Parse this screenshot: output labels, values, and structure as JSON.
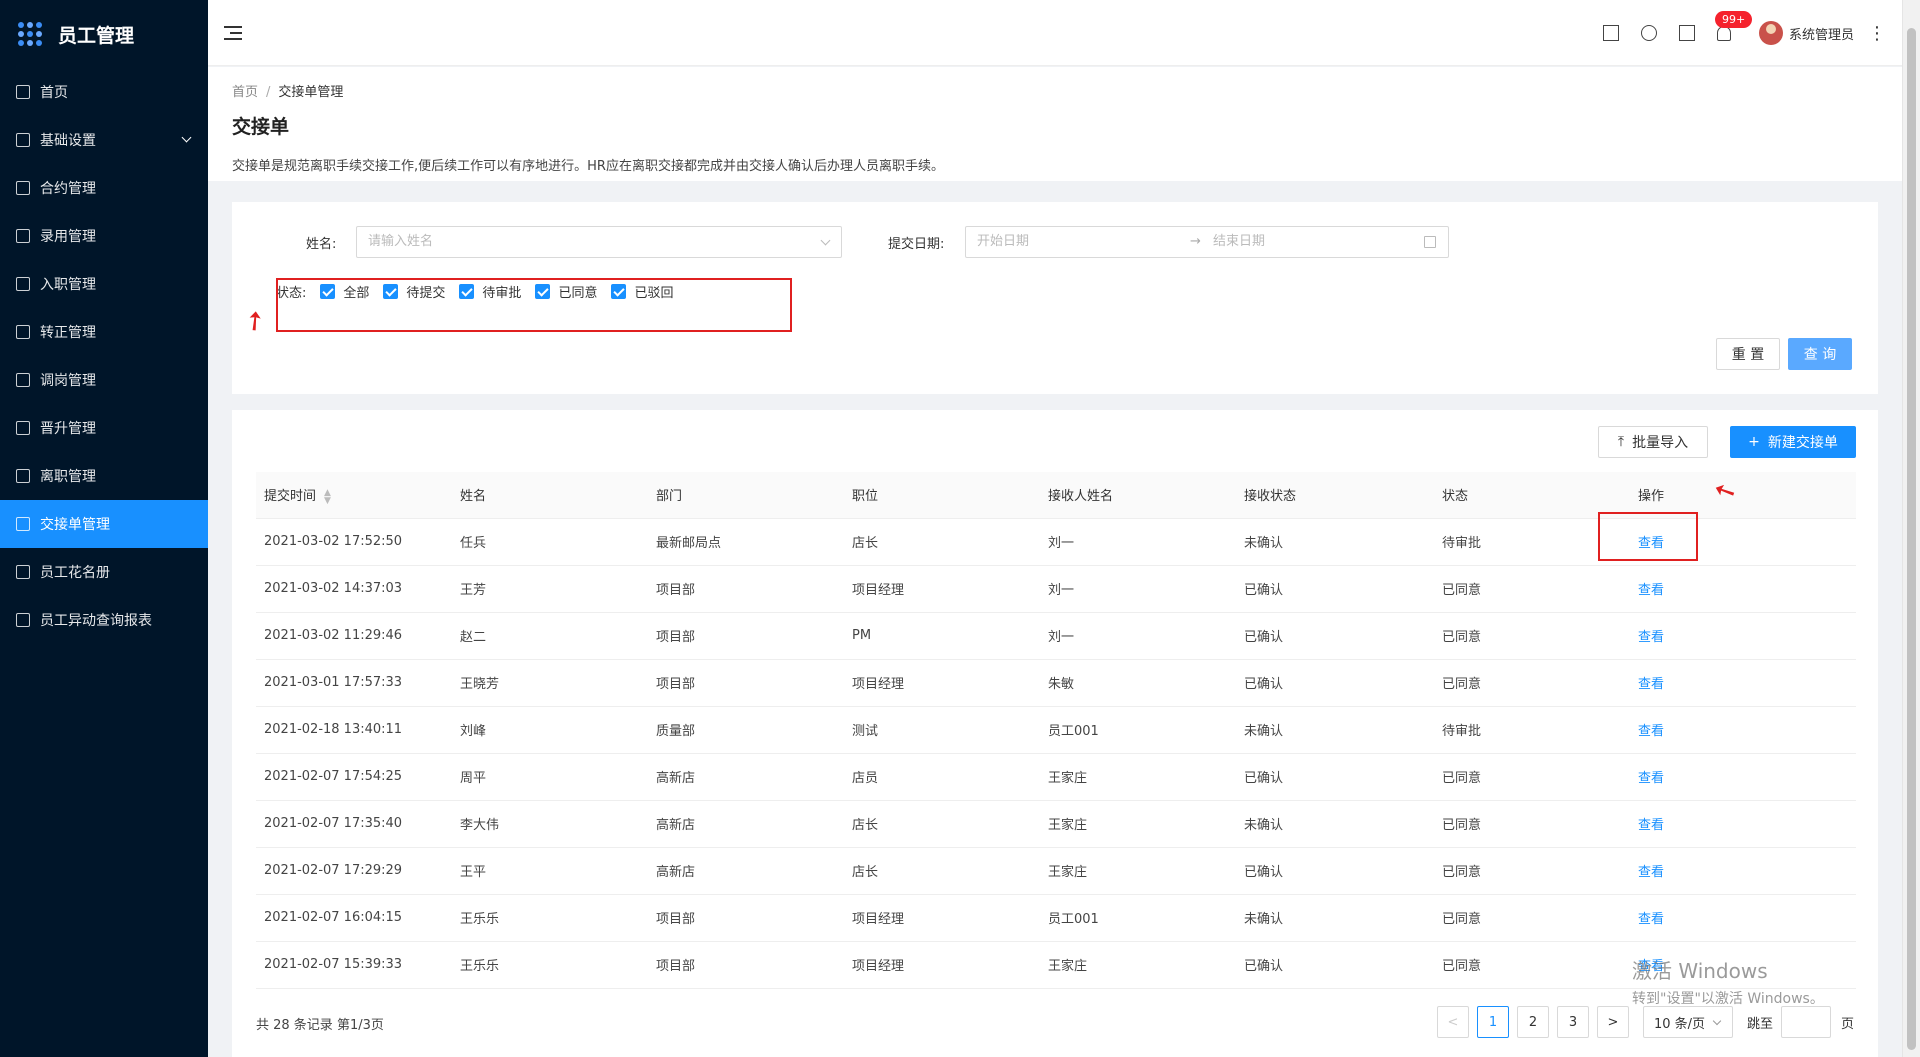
{
  "app": {
    "title": "员工管理"
  },
  "sidebar": {
    "items": [
      {
        "label": "首页"
      },
      {
        "label": "基础设置"
      },
      {
        "label": "合约管理"
      },
      {
        "label": "录用管理"
      },
      {
        "label": "入职管理"
      },
      {
        "label": "转正管理"
      },
      {
        "label": "调岗管理"
      },
      {
        "label": "晋升管理"
      },
      {
        "label": "离职管理"
      },
      {
        "label": "交接单管理"
      },
      {
        "label": "员工花名册"
      },
      {
        "label": "员工异动查询报表"
      }
    ]
  },
  "header": {
    "badge": "99+",
    "username": "系统管理员"
  },
  "breadcrumb": {
    "home": "首页",
    "sep": "/",
    "current": "交接单管理"
  },
  "page": {
    "title": "交接单",
    "description": "交接单是规范离职手续交接工作,便后续工作可以有序地进行。HR应在离职交接都完成并由交接人确认后办理人员离职手续。"
  },
  "filter": {
    "name_label": "姓名:",
    "name_placeholder": "请输入姓名",
    "date_label": "提交日期:",
    "date_start": "开始日期",
    "date_arrow": "→",
    "date_end": "结束日期",
    "status_label": "状态:",
    "status_options": [
      "全部",
      "待提交",
      "待审批",
      "已同意",
      "已驳回"
    ],
    "reset": "重 置",
    "query": "查 询"
  },
  "toolbar": {
    "import": "批量导入",
    "create": "新建交接单"
  },
  "table": {
    "columns": [
      "提交时间",
      "姓名",
      "部门",
      "职位",
      "接收人姓名",
      "接收状态",
      "状态",
      "操作"
    ],
    "rows": [
      [
        "2021-03-02 17:52:50",
        "任兵",
        "最新邮局点",
        "店长",
        "刘一",
        "未确认",
        "待审批",
        "查看"
      ],
      [
        "2021-03-02 14:37:03",
        "王芳",
        "项目部",
        "项目经理",
        "刘一",
        "已确认",
        "已同意",
        "查看"
      ],
      [
        "2021-03-02 11:29:46",
        "赵二",
        "项目部",
        "PM",
        "刘一",
        "已确认",
        "已同意",
        "查看"
      ],
      [
        "2021-03-01 17:57:33",
        "王晓芳",
        "项目部",
        "项目经理",
        "朱敏",
        "已确认",
        "已同意",
        "查看"
      ],
      [
        "2021-02-18 13:40:11",
        "刘峰",
        "质量部",
        "测试",
        "员工001",
        "未确认",
        "待审批",
        "查看"
      ],
      [
        "2021-02-07 17:54:25",
        "周平",
        "高新店",
        "店员",
        "王家庄",
        "已确认",
        "已同意",
        "查看"
      ],
      [
        "2021-02-07 17:35:40",
        "李大伟",
        "高新店",
        "店长",
        "王家庄",
        "未确认",
        "已同意",
        "查看"
      ],
      [
        "2021-02-07 17:29:29",
        "王平",
        "高新店",
        "店长",
        "王家庄",
        "已确认",
        "已同意",
        "查看"
      ],
      [
        "2021-02-07 16:04:15",
        "王乐乐",
        "项目部",
        "项目经理",
        "员工001",
        "未确认",
        "已同意",
        "查看"
      ],
      [
        "2021-02-07 15:39:33",
        "王乐乐",
        "项目部",
        "项目经理",
        "王家庄",
        "已确认",
        "已同意",
        "查看"
      ]
    ]
  },
  "pagination": {
    "summary": "共 28 条记录 第1/3页",
    "pages": [
      "1",
      "2",
      "3"
    ],
    "prev": "<",
    "next": ">",
    "page_size": "10 条/页",
    "jump_label": "跳至",
    "jump_unit": "页"
  },
  "watermark": {
    "line1": "激活 Windows",
    "line2": "转到\"设置\"以激活 Windows。"
  },
  "colors": {
    "primary": "#1890ff",
    "sidebar": "#001529",
    "annotation": "#e02020"
  }
}
